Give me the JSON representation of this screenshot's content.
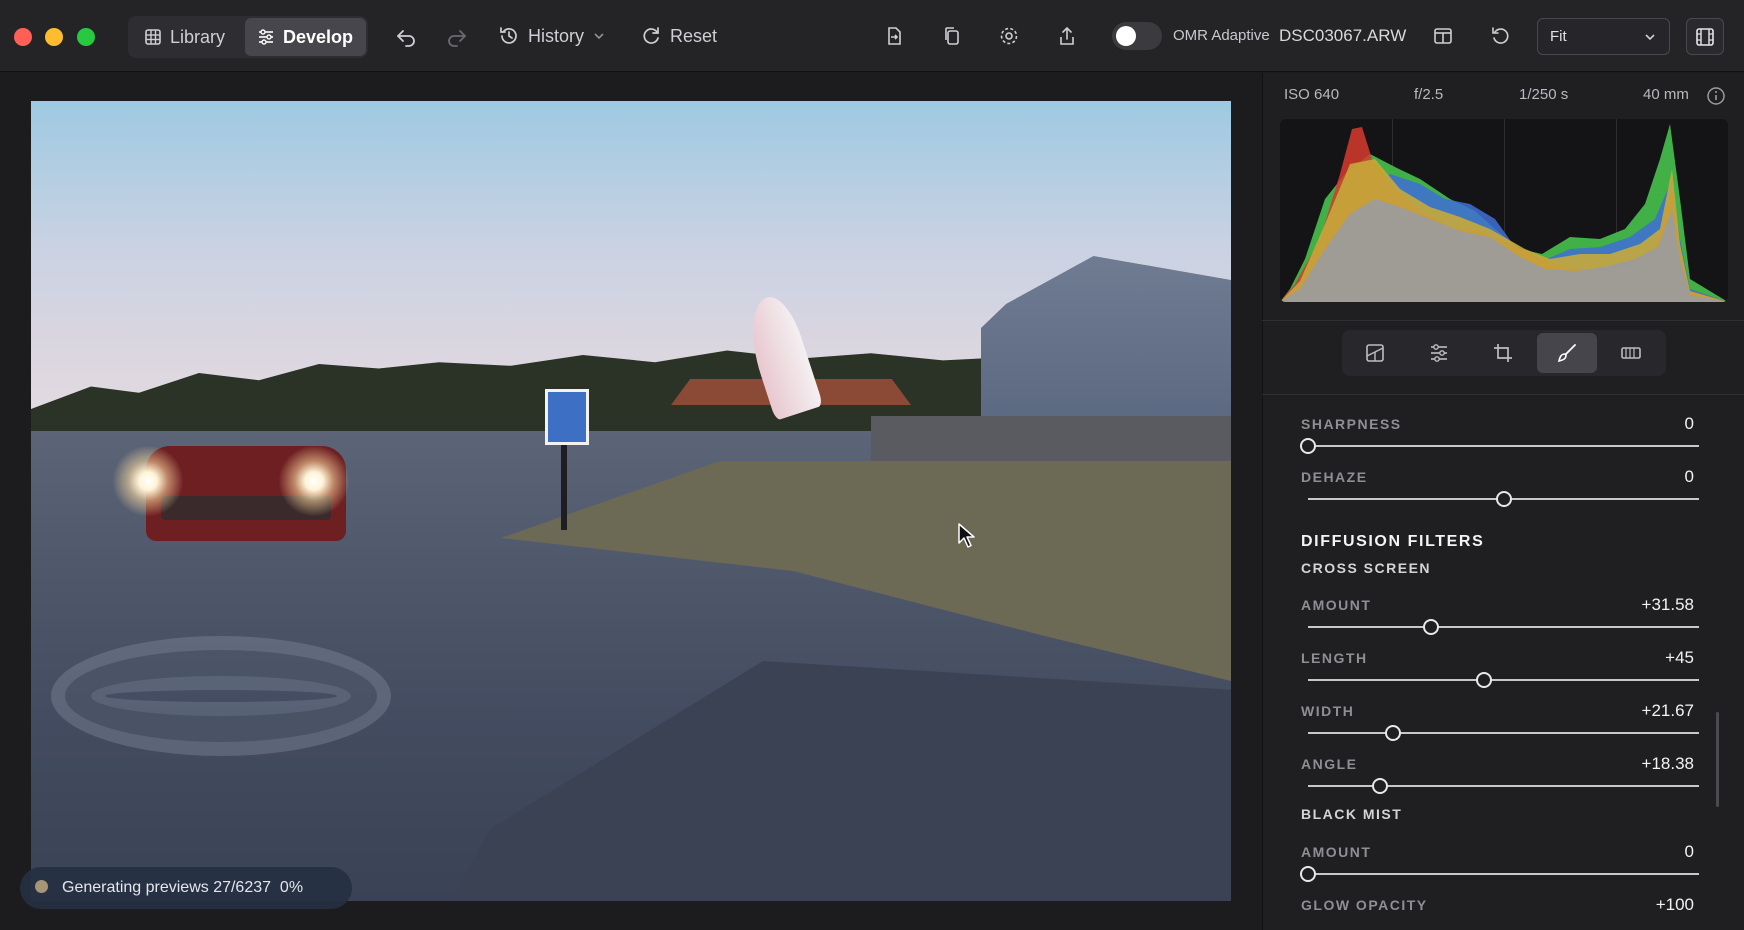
{
  "toolbar": {
    "library_label": "Library",
    "develop_label": "Develop",
    "history_label": "History",
    "reset_label": "Reset",
    "omr_label": "OMR Adaptive",
    "filename": "DSC03067.ARW",
    "zoom_value": "Fit",
    "omr_enabled": false,
    "icons": [
      "grid-icon",
      "sliders-icon",
      "undo-icon",
      "redo-icon",
      "history-icon",
      "chevron-down-icon",
      "reset-icon",
      "import-icon",
      "copy-icon",
      "gear-icon",
      "share-icon",
      "compare-icon",
      "rotate-icon",
      "filmstrip-icon"
    ]
  },
  "canvas": {
    "status_text": "Generating previews 27/6237  0%"
  },
  "panel": {
    "exif": {
      "iso": "ISO 640",
      "aperture": "f/2.5",
      "shutter": "1/250 s",
      "focal": "40 mm"
    },
    "tool_tabs": [
      "presets-icon",
      "adjust-icon",
      "crop-icon",
      "brush-icon",
      "film-icon"
    ],
    "active_tab": "brush-icon",
    "adjustments": {
      "sharpness": {
        "label": "SHARPNESS",
        "value": "0",
        "level": 0.0
      },
      "dehaze": {
        "label": "DEHAZE",
        "value": "0",
        "level": 0.5
      },
      "section_title": "DIFFUSION FILTERS",
      "cross_screen_title": "CROSS SCREEN",
      "cs_amount": {
        "label": "AMOUNT",
        "value": "+31.58",
        "level": 0.3158
      },
      "cs_length": {
        "label": "LENGTH",
        "value": "+45",
        "level": 0.45
      },
      "cs_width": {
        "label": "WIDTH",
        "value": "+21.67",
        "level": 0.2167
      },
      "cs_angle": {
        "label": "ANGLE",
        "value": "+18.38",
        "level": 0.1838
      },
      "black_mist_title": "BLACK MIST",
      "bm_amount": {
        "label": "AMOUNT",
        "value": "0",
        "level": 0.0
      },
      "bm_glow": {
        "label": "GLOW OPACITY",
        "value": "+100"
      }
    }
  },
  "colors": {
    "accent_red": "#ff5f57",
    "accent_yellow": "#febc2e",
    "accent_green": "#28c840"
  }
}
